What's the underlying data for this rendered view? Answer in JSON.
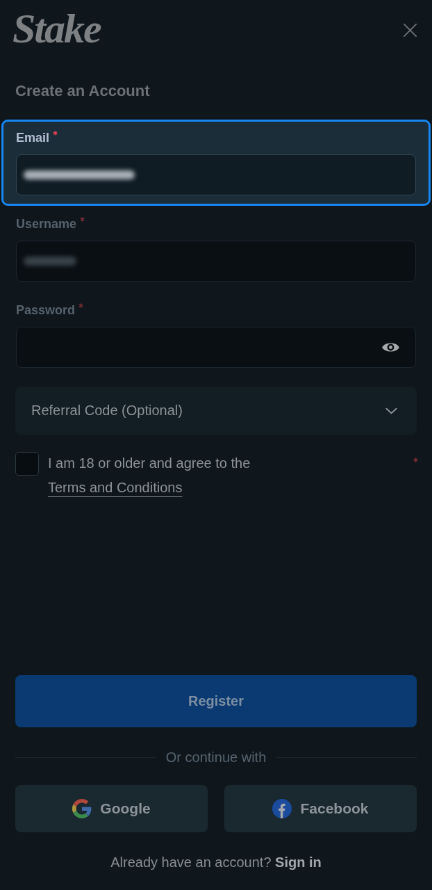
{
  "header": {
    "logo": "Stake"
  },
  "title": "Create an Account",
  "fields": [
    {
      "label": "Email",
      "kind": "email",
      "required": true,
      "highlighted": true,
      "value_blurred": true
    },
    {
      "label": "Username",
      "kind": "username",
      "required": true,
      "highlighted": false,
      "value_blurred": true
    },
    {
      "label": "Password",
      "kind": "password",
      "required": true,
      "highlighted": false,
      "value_blurred": false
    }
  ],
  "referral": {
    "label": "Referral Code (Optional)",
    "expanded": false
  },
  "terms": {
    "text": "I am 18 or older and agree to the",
    "link": "Terms and Conditions",
    "checked": false,
    "required": true
  },
  "register_button": {
    "label": "Register"
  },
  "divider_text": "Or continue with",
  "social_buttons": [
    {
      "label": "Google",
      "kind": "google"
    },
    {
      "label": "Facebook",
      "kind": "facebook"
    }
  ],
  "footer": {
    "text": "Already have an account?",
    "link": "Sign in"
  }
}
